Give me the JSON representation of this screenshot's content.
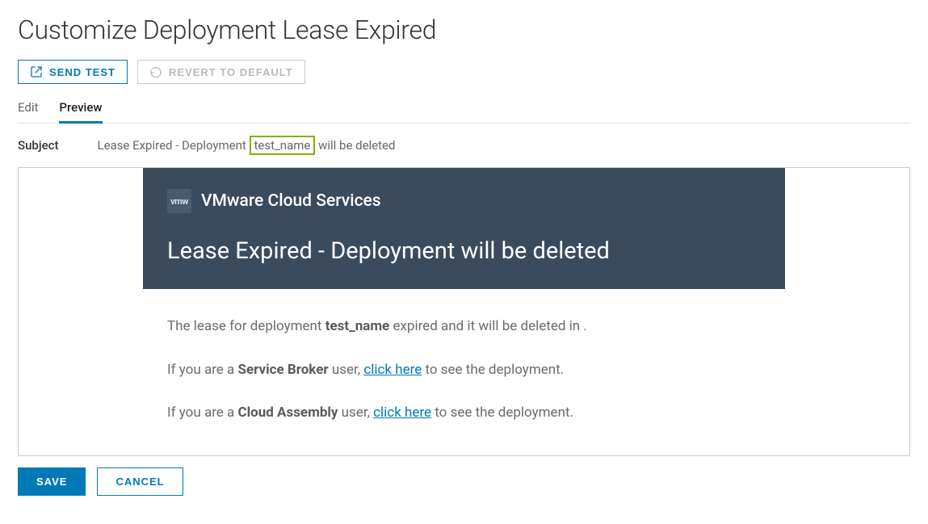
{
  "page": {
    "title": "Customize Deployment Lease Expired"
  },
  "toolbar": {
    "send_test": "Send Test",
    "revert": "Revert to Default"
  },
  "tabs": {
    "edit": "Edit",
    "preview": "Preview",
    "active": "preview"
  },
  "subject": {
    "label": "Subject",
    "prefix": "Lease Expired - Deployment ",
    "token": "test_name",
    "suffix": " will be deleted"
  },
  "email": {
    "brand_mark": "vmw",
    "brand_name": "VMware Cloud Services",
    "title": "Lease Expired - Deployment will be deleted",
    "body": {
      "line1_pre": "The lease for deployment ",
      "line1_token": "test_name",
      "line1_post": " expired and it will be deleted in .",
      "line2_pre": "If you are a ",
      "line2_role": "Service Broker",
      "line2_mid": " user, ",
      "line2_link": "click here",
      "line2_post": " to see the deployment.",
      "line3_pre": "If you are a ",
      "line3_role": "Cloud Assembly",
      "line3_mid": " user, ",
      "line3_link": "click here",
      "line3_post": " to see the deployment."
    }
  },
  "actions": {
    "save": "Save",
    "cancel": "Cancel"
  }
}
